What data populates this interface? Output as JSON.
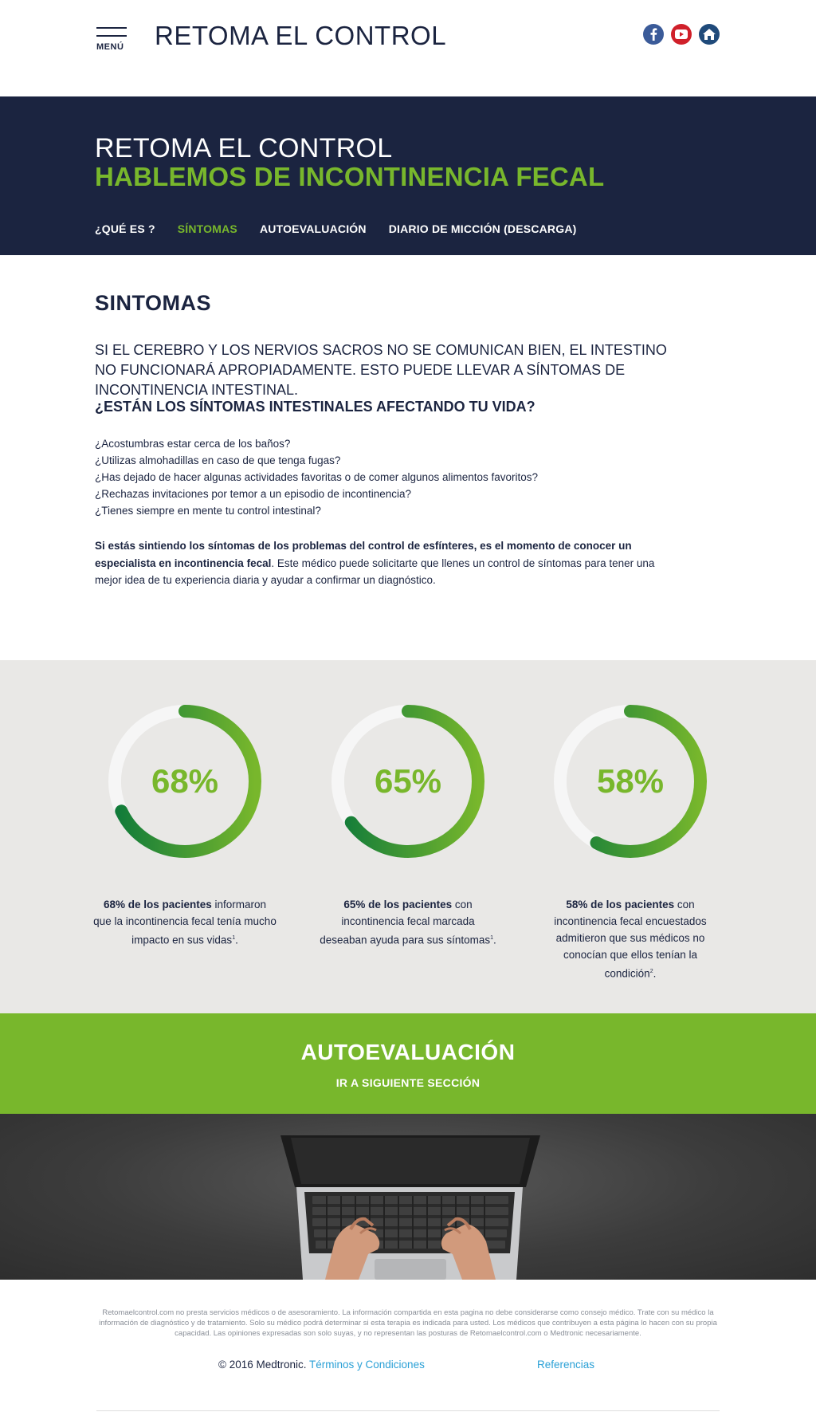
{
  "header": {
    "menu_label": "MENÚ",
    "site_title": "RETOMA EL CONTROL",
    "social": [
      "facebook-icon",
      "youtube-icon",
      "home-icon"
    ]
  },
  "hero": {
    "line1": "RETOMA EL CONTROL",
    "line2": "HABLEMOS DE INCONTINENCIA FECAL",
    "nav": [
      {
        "label": "¿QUÉ ES ?",
        "active": false
      },
      {
        "label": "SÍNTOMAS",
        "active": true
      },
      {
        "label": "AUTOEVALUACIÓN",
        "active": false
      },
      {
        "label": "DIARIO DE MICCIÓN  (DESCARGA)",
        "active": false
      }
    ]
  },
  "content": {
    "title": "SINTOMAS",
    "lead": "SI EL CEREBRO Y LOS NERVIOS SACROS NO SE COMUNICAN BIEN, EL INTESTINO NO FUNCIONARÁ APROPIADAMENTE.  ESTO PUEDE LLEVAR A SÍNTOMAS DE INCONTINENCIA INTESTINAL.",
    "lead_question": "¿ESTÁN LOS SÍNTOMAS INTESTINALES AFECTANDO TU VIDA?",
    "questions": [
      "¿Acostumbras estar cerca de los baños?",
      "¿Utilizas almohadillas en caso de que tenga fugas?",
      "¿Has dejado de hacer algunas actividades favoritas o de comer algunos alimentos favoritos?",
      "¿Rechazas invitaciones por temor a un episodio de incontinencia?",
      "¿Tienes siempre en mente tu control intestinal?"
    ],
    "para_bold": "Si estás sintiendo los síntomas de los problemas del control de esfínteres, es el momento de conocer un especialista en incontinencia fecal",
    "para_rest": ". Este médico puede solicitarte que llenes un control de síntomas para tener una mejor idea de tu experiencia diaria y ayudar a confirmar un diagnóstico."
  },
  "stats": [
    {
      "percent": 68,
      "label": "68%",
      "bold": "68% de los pacientes",
      "text": " informaron que la incontinencia fecal tenía mucho impacto en sus vidas",
      "ref": "1",
      "tail": "."
    },
    {
      "percent": 65,
      "label": "65%",
      "bold": "65% de los pacientes",
      "text": " con incontinencia fecal marcada deseaban ayuda para sus síntomas",
      "ref": "1",
      "tail": "."
    },
    {
      "percent": 58,
      "label": "58%",
      "bold": "58% de los pacientes",
      "text": " con incontinencia fecal encuestados admitieron que sus médicos no conocían que ellos tenían la condición",
      "ref": "2",
      "tail": "."
    }
  ],
  "cta": {
    "title": "AUTOEVALUACIÓN",
    "subtitle": "IR A SIGUIENTE SECCIÓN"
  },
  "footer": {
    "disclaimer": "Retomaelcontrol.com no presta servicios médicos o de asesoramiento. La información compartida en esta pagina no debe considerarse como consejo médico. Trate con su médico la información de diagnóstico y de tratamiento. Solo su médico podrá determinar si esta terapia es indicada para usted. Los médicos que contribuyen a esta página lo hacen con su propia capacidad. Las opiniones expresadas son solo suyas, y no representan las posturas de Retomaelcontrol.com o Medtronic necesariamente.",
    "copyright": "© 2016 Medtronic. ",
    "terms": "Términos y Condiciones",
    "references": "Referencias"
  },
  "colors": {
    "navy": "#1b2440",
    "green": "#78b72c",
    "dark_green": "#0f7a3a",
    "link": "#2aa0d6",
    "stats_bg": "#e9e8e6"
  }
}
